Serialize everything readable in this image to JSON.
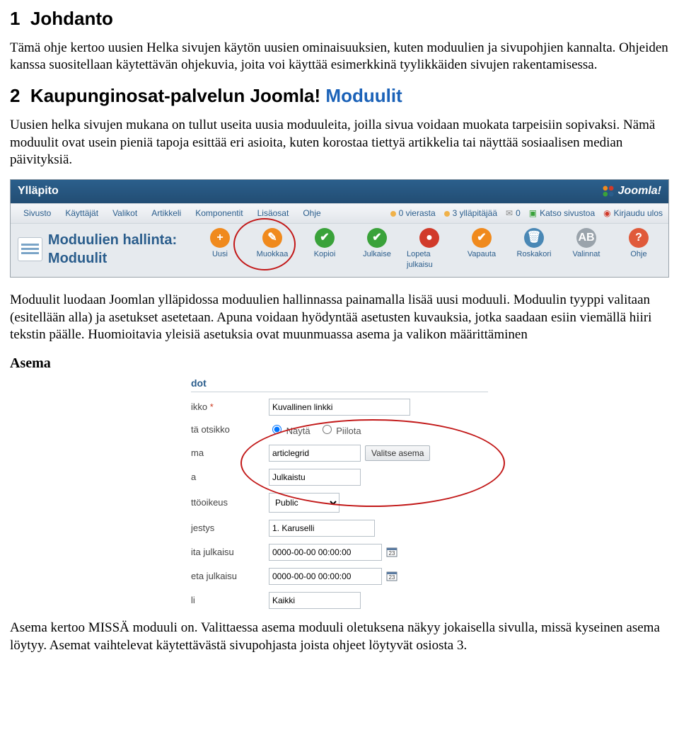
{
  "h1": {
    "num": "1",
    "title": "Johdanto"
  },
  "p1": "Tämä ohje kertoo uusien Helka sivujen käytön uusien ominaisuuksien, kuten moduulien ja sivupohjien kannalta. Ohjeiden kanssa suositellaan käytettävän ohjekuvia, joita voi käyttää esimerkkinä tyylikkäiden sivujen rakentamisessa.",
  "h2": {
    "num": "2",
    "title_black": "Kaupunginosat-palvelun Joomla!",
    "title_blue": "Moduulit"
  },
  "p2": "Uusien helka sivujen mukana on tullut useita uusia moduuleita, joilla sivua voidaan muokata tarpeisiin sopivaksi. Nämä moduulit ovat usein pieniä tapoja esittää eri asioita, kuten korostaa tiettyä artikkelia tai näyttää sosiaalisen median päivityksiä.",
  "joomla": {
    "header": "Ylläpito",
    "logo": "Joomla!",
    "menu": [
      "Sivusto",
      "Käyttäjät",
      "Valikot",
      "Artikkeli",
      "Komponentit",
      "Lisäosat",
      "Ohje"
    ],
    "status": {
      "vierasta": "0 vierasta",
      "yllapitajaa": "3 ylläpitäjää",
      "eiviestejae": "0",
      "katso": "Katso sivustoa",
      "kirjaudu": "Kirjaudu ulos"
    },
    "page_title": "Moduulien hallinta: Moduulit",
    "tools": [
      {
        "label": "Uusi",
        "color": "#f08a1d",
        "glyph": "+"
      },
      {
        "label": "Muokkaa",
        "color": "#f08a1d",
        "glyph": "✎"
      },
      {
        "label": "Kopioi",
        "color": "#3aa23a",
        "glyph": "✔"
      },
      {
        "label": "Julkaise",
        "color": "#3aa23a",
        "glyph": "✔"
      },
      {
        "label": "Lopeta julkaisu",
        "color": "#d13a2a",
        "glyph": "●"
      },
      {
        "label": "Vapauta",
        "color": "#f08a1d",
        "glyph": "✔"
      },
      {
        "label": "Roskakori",
        "color": "#4a88b5",
        "glyph": "🗑"
      },
      {
        "label": "Valinnat",
        "color": "#9aa3ab",
        "glyph": "AB"
      },
      {
        "label": "Ohje",
        "color": "#e05a3a",
        "glyph": "?"
      }
    ]
  },
  "p3": "Moduulit luodaan Joomlan ylläpidossa moduulien hallinnassa painamalla lisää uusi moduuli. Moduulin tyyppi valitaan (esitellään alla) ja asetukset asetetaan. Apuna voidaan hyödyntää asetusten kuvauksia, jotka saadaan esiin viemällä hiiri tekstin päälle. Huomioitavia yleisiä asetuksia ovat muunmuassa asema ja valikon määrittäminen",
  "asema_heading": "Asema",
  "form": {
    "tab": "dot",
    "rows": {
      "ikko": {
        "label": "ikko",
        "value": "Kuvallinen linkki"
      },
      "ta_otsikko": {
        "label": "tä otsikko",
        "opt1": "Näytä",
        "opt2": "Piilota"
      },
      "ma": {
        "label": "ma",
        "value": "articlegrid",
        "btn": "Valitse asema"
      },
      "a": {
        "label": "a",
        "value": "Julkaistu"
      },
      "ttooikeus": {
        "label": "ttöoikeus",
        "value": "Public"
      },
      "jestys": {
        "label": "jestys",
        "value": "1. Karuselli"
      },
      "ita": {
        "label": "ita julkaisu",
        "value": "0000-00-00 00:00:00"
      },
      "eta": {
        "label": "eta julkaisu",
        "value": "0000-00-00 00:00:00"
      },
      "li": {
        "label": "li",
        "value": "Kaikki"
      }
    }
  },
  "p4": "Asema kertoo MISSÄ moduuli on. Valittaessa asema moduuli oletuksena näkyy jokaisella sivulla, missä kyseinen asema löytyy. Asemat vaihtelevat käytettävästä sivupohjasta joista ohjeet löytyvät osiosta 3."
}
